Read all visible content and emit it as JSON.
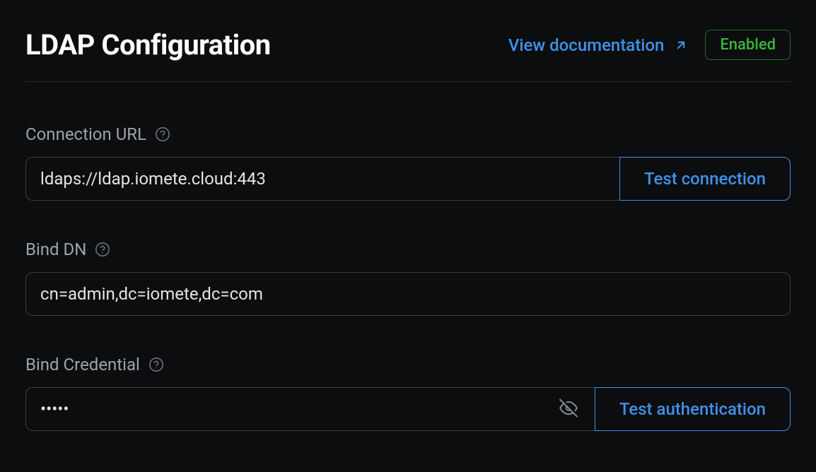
{
  "header": {
    "title": "LDAP Configuration",
    "doc_link_label": "View documentation",
    "status_label": "Enabled"
  },
  "fields": {
    "connection_url": {
      "label": "Connection URL",
      "value": "ldaps://ldap.iomete.cloud:443",
      "button_label": "Test connection"
    },
    "bind_dn": {
      "label": "Bind DN",
      "value": "cn=admin,dc=iomete,dc=com"
    },
    "bind_credential": {
      "label": "Bind Credential",
      "value": "•••••",
      "button_label": "Test authentication"
    }
  }
}
